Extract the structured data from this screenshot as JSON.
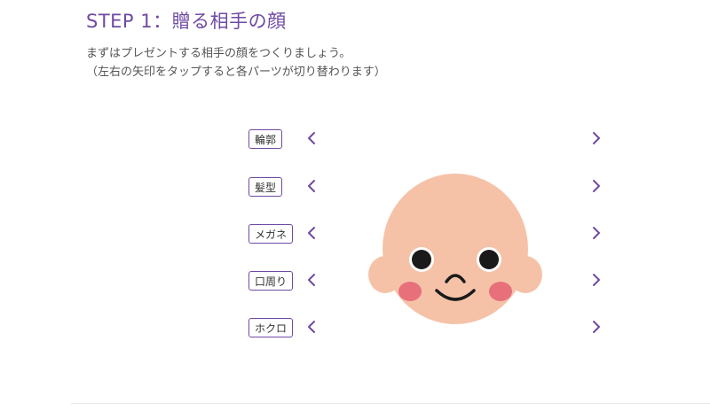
{
  "step": {
    "title": "STEP 1：贈る相手の顔"
  },
  "description": {
    "line1": "まずはプレゼントする相手の顔をつくりましょう。",
    "line2": "（左右の矢印をタップすると各パーツが切り替わります）"
  },
  "parts": [
    {
      "label": "輪郭"
    },
    {
      "label": "髪型"
    },
    {
      "label": "メガネ"
    },
    {
      "label": "口周り"
    },
    {
      "label": "ホクロ"
    }
  ],
  "icons": {
    "left": "chevron-left-icon",
    "right": "chevron-right-icon"
  },
  "colors": {
    "accent": "#6f4aa3",
    "skin": "#f5c2a8",
    "cheek": "#e8707a"
  }
}
